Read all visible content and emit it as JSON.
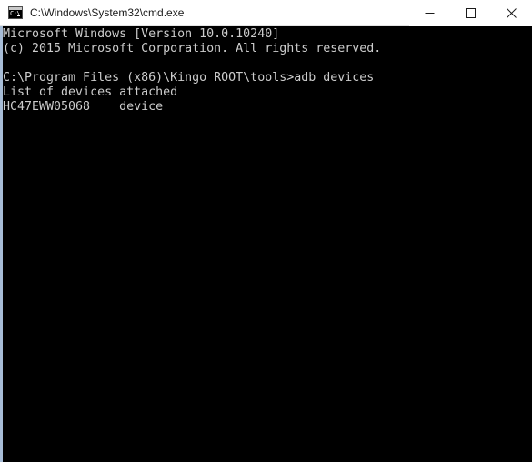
{
  "window": {
    "title": "C:\\Windows\\System32\\cmd.exe",
    "icon": "cmd-console-icon",
    "icon_text": "C:\\",
    "background_color": "#000000",
    "titlebar_color": "#ffffff",
    "frame_accent_color": "#a7bcd6"
  },
  "controls": {
    "minimize_label": "Minimize",
    "maximize_label": "Maximize",
    "close_label": "Close"
  },
  "console": {
    "foreground_color": "#cccccc",
    "background_color": "#000000",
    "lines": [
      "Microsoft Windows [Version 10.0.10240]",
      "(c) 2015 Microsoft Corporation. All rights reserved.",
      "",
      "C:\\Program Files (x86)\\Kingo ROOT\\tools>adb devices",
      "List of devices attached",
      "HC47EWW05068    device"
    ],
    "text": "Microsoft Windows [Version 10.0.10240]\n(c) 2015 Microsoft Corporation. All rights reserved.\n\nC:\\Program Files (x86)\\Kingo ROOT\\tools>adb devices\nList of devices attached\nHC47EWW05068    device",
    "prompt_path": "C:\\Program Files (x86)\\Kingo ROOT\\tools>",
    "command": "adb devices",
    "device_serial": "HC47EWW05068",
    "device_state": "device"
  }
}
